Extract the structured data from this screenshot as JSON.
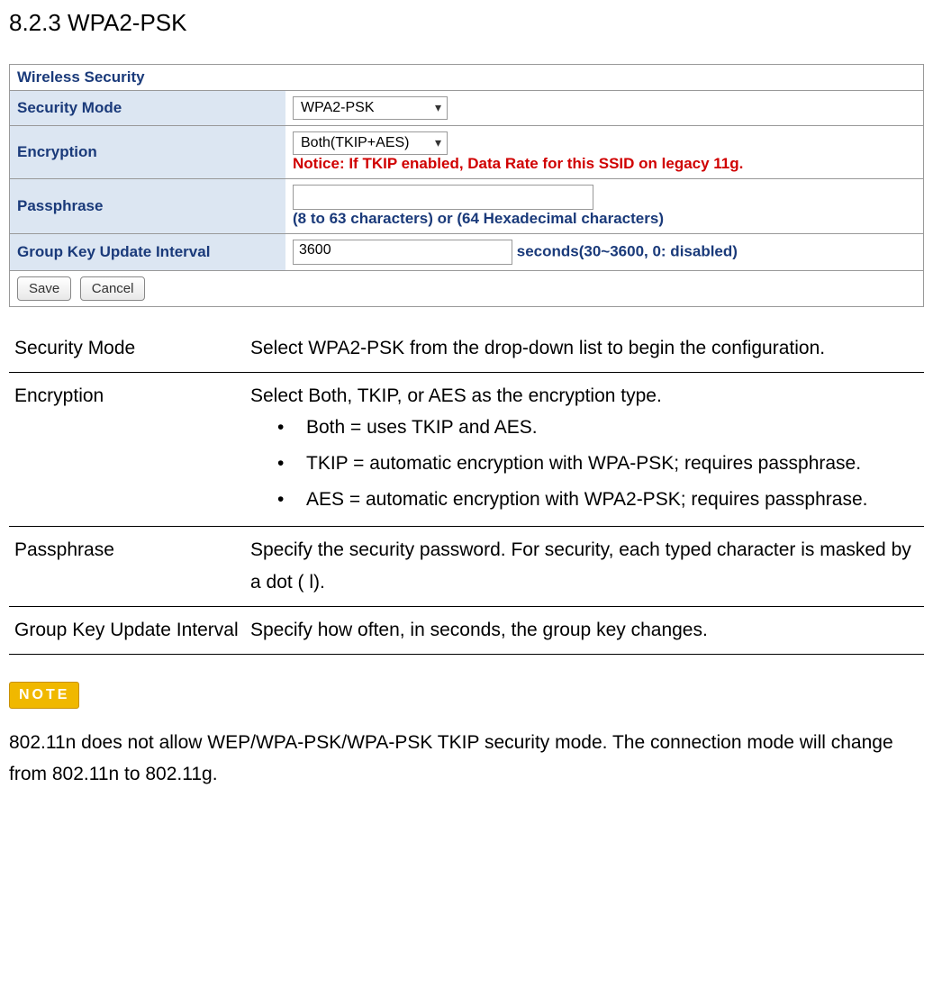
{
  "heading": "8.2.3 WPA2-PSK",
  "panel": {
    "title": "Wireless Security",
    "rows": {
      "security_mode": {
        "label": "Security Mode",
        "value": "WPA2-PSK"
      },
      "encryption": {
        "label": "Encryption",
        "value": "Both(TKIP+AES)",
        "notice": "Notice: If TKIP enabled, Data Rate for this SSID on legacy 11g."
      },
      "passphrase": {
        "label": "Passphrase",
        "value": "",
        "help": "(8 to 63 characters) or (64 Hexadecimal characters)"
      },
      "group_key": {
        "label": "Group Key Update Interval",
        "value": "3600",
        "suffix": "seconds(30~3600, 0: disabled)"
      }
    },
    "buttons": {
      "save": "Save",
      "cancel": "Cancel"
    }
  },
  "desc": {
    "security_mode": {
      "term": "Security Mode",
      "text": "Select WPA2-PSK from the drop-down  list to begin the configuration."
    },
    "encryption": {
      "term": "Encryption",
      "intro": "Select Both, TKIP, or AES as the encryption type.",
      "items": [
        "Both = uses TKIP and AES.",
        "TKIP = automatic encryption with WPA-PSK; requires passphrase.",
        "AES = automatic encryption with WPA2-PSK; requires passphrase."
      ]
    },
    "passphrase": {
      "term": "Passphrase",
      "text": "Specify the security password. For security, each typed character is masked by a dot  (    l)."
    },
    "group_key": {
      "term": "Group Key Update Interval",
      "text": "Specify how often, in seconds, the group key changes."
    }
  },
  "note": {
    "badge": "NOTE",
    "text": "802.11n does not allow WEP/WPA-PSK/WPA-PSK TKIP security mode. The connection mode will change from 802.11n to 802.11g."
  }
}
